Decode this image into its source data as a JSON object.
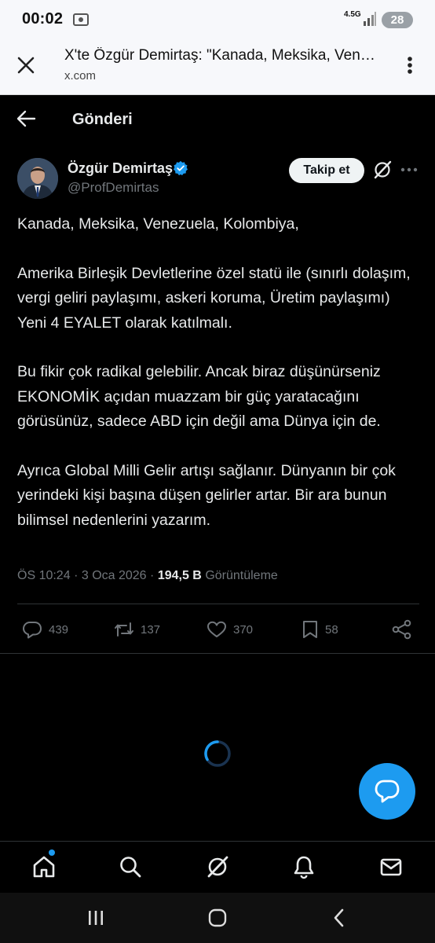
{
  "status_bar": {
    "time": "00:02",
    "network": "4.5G",
    "battery": "28"
  },
  "browser": {
    "page_title": "X'te Özgür Demirtaş: \"Kanada, Meksika, Venezuela, Kolombiya,...",
    "domain": "x.com"
  },
  "nav": {
    "title": "Gönderi"
  },
  "post": {
    "author_name": "Özgür Demirtaş",
    "handle": "@ProfDemirtas",
    "follow_label": "Takip et",
    "text": "Kanada, Meksika, Venezuela, Kolombiya,\n\nAmerika Birleşik Devletlerine özel statü ile (sınırlı dolaşım,  vergi geliri paylaşımı, askeri koruma, Üretim paylaşımı) Yeni 4 EYALET olarak katılmalı.\n\nBu fikir çok radikal gelebilir. Ancak biraz düşünürseniz EKONOMİK açıdan muazzam bir güç yaratacağını görüsünüz, sadece ABD için değil ama Dünya için de.\n\nAyrıca Global Milli Gelir artışı sağlanır. Dünyanın bir çok yerindeki kişi başına düşen gelirler artar. Bir ara bunun bilimsel nedenlerini yazarım.",
    "time": "ÖS 10:24",
    "date": "3 Oca 2026",
    "separator": "·",
    "views_count": "194,5 B",
    "views_label": "Görüntüleme",
    "replies": "439",
    "reposts": "137",
    "likes": "370",
    "bookmarks": "58"
  },
  "colors": {
    "accent": "#1d9bf0",
    "background": "#000000",
    "secondary_text": "#71767b"
  },
  "icons": {
    "browser": [
      "close-icon",
      "more-vertical-icon"
    ],
    "post": [
      "back-arrow-icon",
      "verified-badge-icon",
      "grok-icon",
      "more-horizontal-icon",
      "reply-icon",
      "repost-icon",
      "like-icon",
      "bookmark-icon",
      "share-icon",
      "loading-spinner-icon",
      "compose-icon"
    ],
    "bottom_nav": [
      "home-icon",
      "search-icon",
      "grok-icon",
      "notifications-icon",
      "messages-icon"
    ],
    "system_nav": [
      "recents-icon",
      "home-button-icon",
      "back-icon"
    ]
  }
}
